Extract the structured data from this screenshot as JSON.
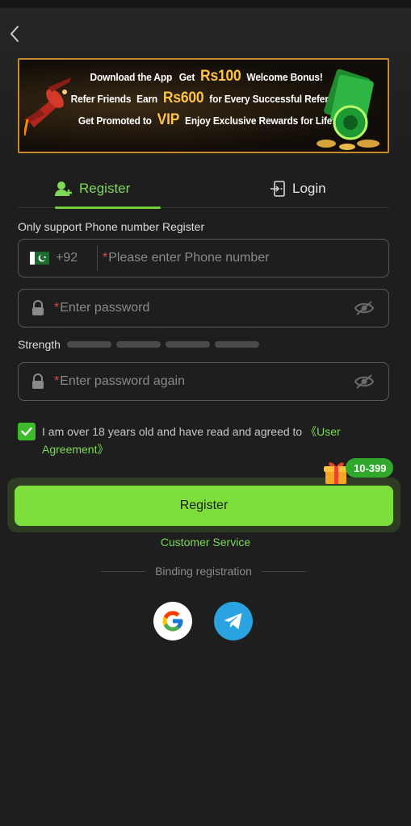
{
  "banner": {
    "line1_pre": "Download the App",
    "line1_mid": "Get",
    "line1_hl": "Rs100",
    "line1_post": "Welcome Bonus!",
    "line2_pre": "Refer Friends",
    "line2_mid": "Earn",
    "line2_hl": "Rs600",
    "line2_post": "for Every Successful Referral!",
    "line3_pre": "Get Promoted to",
    "line3_hl": "VIP",
    "line3_post": "Enjoy Exclusive Rewards for Life!"
  },
  "tabs": {
    "register": "Register",
    "login": "Login"
  },
  "note": "Only support Phone number Register",
  "phone": {
    "country_code": "+92",
    "required_mark": "*",
    "placeholder": "Please enter Phone number"
  },
  "password": {
    "required_mark": "*",
    "placeholder": "Enter password"
  },
  "strength": {
    "label": "Strength"
  },
  "password_again": {
    "required_mark": "*",
    "placeholder": "Enter password again"
  },
  "agreement": {
    "text": "I am over 18 years old and have read and agreed to ",
    "link": "《User Agreement》",
    "checked": true
  },
  "register_button": "Register",
  "bonus_badge": "10-399",
  "customer_service": "Customer Service",
  "binding_label": "Binding registration",
  "colors": {
    "accent": "#7edf3c",
    "link": "#7ed956",
    "background": "#1e1e1e"
  },
  "icons": {
    "back": "chevron-left-icon",
    "register_tab": "add-user-icon",
    "login_tab": "login-door-icon",
    "flag": "pakistan-flag-icon",
    "lock": "lock-icon",
    "eye": "eye-off-icon",
    "check": "check-icon",
    "gift": "gift-icon",
    "google": "google-icon",
    "telegram": "telegram-icon"
  }
}
